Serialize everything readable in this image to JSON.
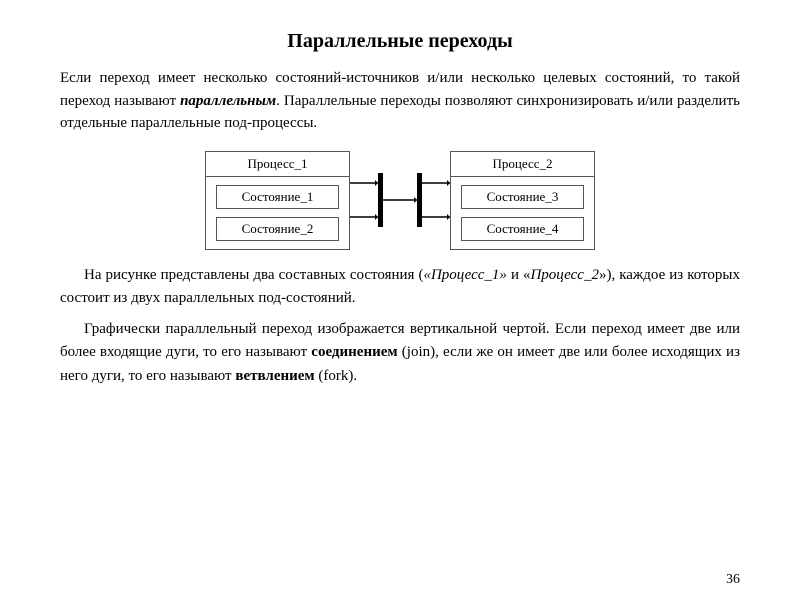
{
  "title": "Параллельные переходы",
  "intro": "Если переход имеет несколько состояний-источников и/или несколько целевых состояний, то такой переход называют ",
  "intro_bold": "параллельным",
  "intro2": ". Параллельные переходы позволяют синхронизировать и/или разделить отдельные параллельные под-процессы.",
  "process1": {
    "title": "Процесс_1",
    "state1": "Состояние_1",
    "state2": "Состояние_2"
  },
  "process2": {
    "title": "Процесс_2",
    "state3": "Состояние_3",
    "state4": "Состояние_4"
  },
  "para1_start": "На рисунке представлены два составных состояния (",
  "para1_italic": "«Процесс_1»",
  "para1_mid": " и «",
  "para1_italic2": "Процесс_2",
  "para1_end": "»), каждое из которых состоит из двух параллельных под-состояний.",
  "para2": "Графически параллельный переход изображается вертикальной чертой. Если переход имеет две или более входящие дуги, то его называют ",
  "para2_bold": "соединением",
  "para2_mid": " (join), если же он имеет две или более исходящих из него дуги, то его называют ",
  "para2_bold2": "ветвлением",
  "para2_end": " (fork).",
  "page_number": "36"
}
